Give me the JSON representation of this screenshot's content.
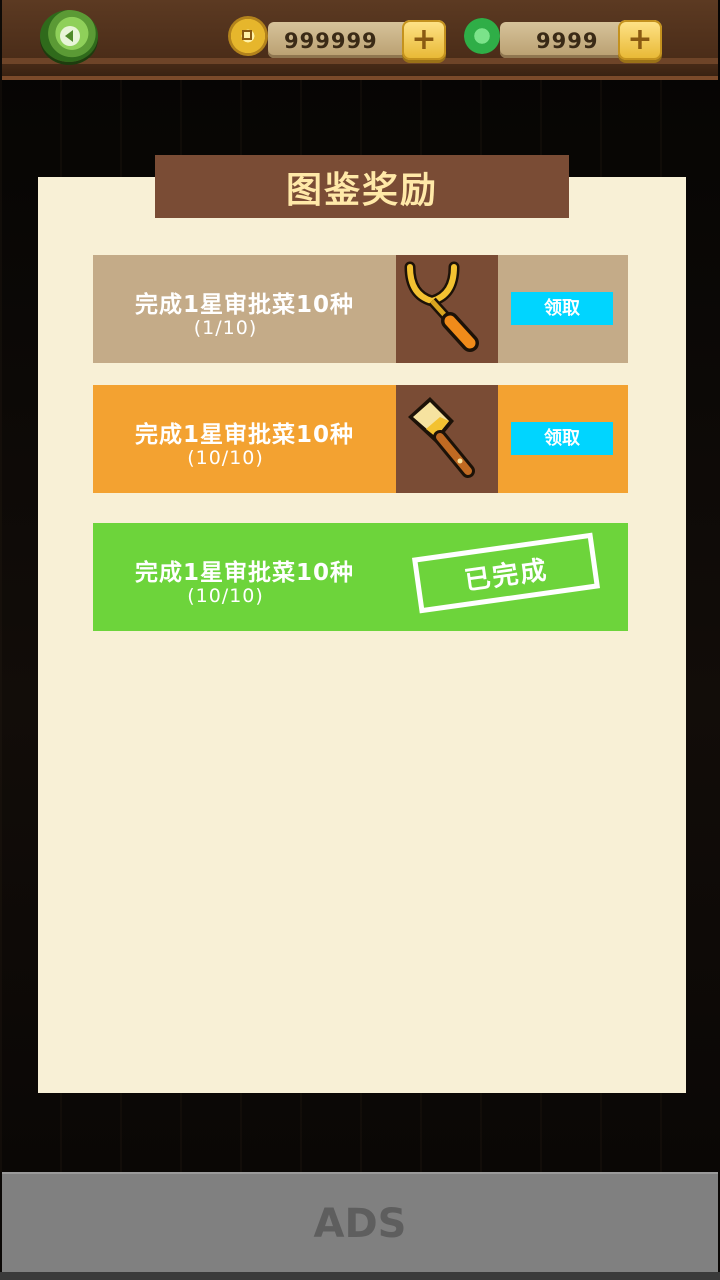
{
  "header": {
    "coins": "999999",
    "gems": "9999",
    "plus_label": "+"
  },
  "panel": {
    "title": "图鉴奖励"
  },
  "rewards": [
    {
      "task": "完成1星审批菜10种",
      "progress": "(1/10)",
      "tool": "fork-tool-icon",
      "action": "领取",
      "color": "#c4ab88"
    },
    {
      "task": "完成1星审批菜10种",
      "progress": "(10/10)",
      "tool": "spatula-tool-icon",
      "action": "领取",
      "color": "#f3a231"
    },
    {
      "task": "完成1星审批菜10种",
      "progress": "(10/10)",
      "status": "已完成",
      "color": "#6dd43b"
    }
  ],
  "ads": {
    "label": "ADS"
  }
}
